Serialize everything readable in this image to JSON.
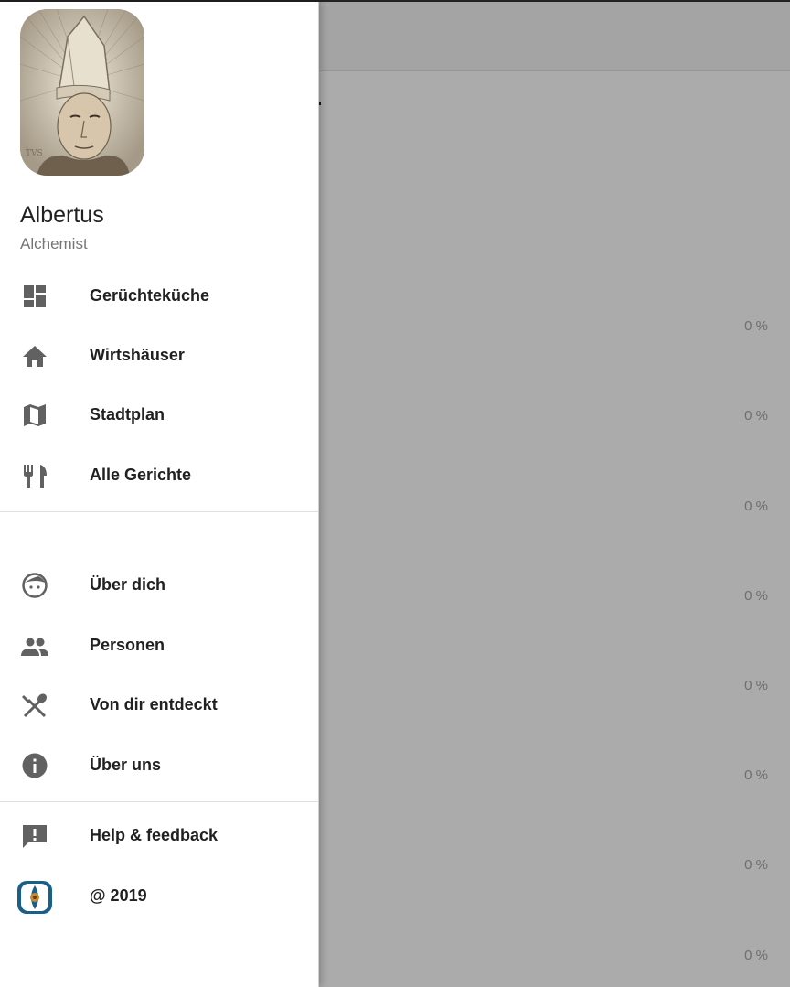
{
  "user": {
    "name": "Albertus",
    "role": "Alchemist",
    "avatar_icon": "portrait-avatar"
  },
  "nav": {
    "primary": [
      {
        "label": "Gerüchteküche",
        "icon": "dashboard-icon"
      },
      {
        "label": "Wirtshäuser",
        "icon": "home-icon"
      },
      {
        "label": "Stadtplan",
        "icon": "map-icon"
      },
      {
        "label": "Alle Gerichte",
        "icon": "restaurant-icon"
      }
    ],
    "secondary": [
      {
        "label": "Über dich",
        "icon": "face-icon"
      },
      {
        "label": "Personen",
        "icon": "people-icon"
      },
      {
        "label": "Von dir entdeckt",
        "icon": "spoon-fork-icon"
      },
      {
        "label": "Über uns",
        "icon": "info-icon"
      }
    ],
    "footer": [
      {
        "label": "Help & feedback",
        "icon": "feedback-icon"
      },
      {
        "label": "@ 2019",
        "icon": "app-logo-icon"
      }
    ]
  },
  "background": {
    "percent_labels": [
      "0 %",
      "0 %",
      "0 %",
      "0 %",
      "0 %",
      "0 %",
      "0 %",
      "0 %"
    ]
  },
  "colors": {
    "icon": "#616161",
    "text": "#212121",
    "scrim": "#adadad",
    "logo": "#1a5f8a"
  }
}
